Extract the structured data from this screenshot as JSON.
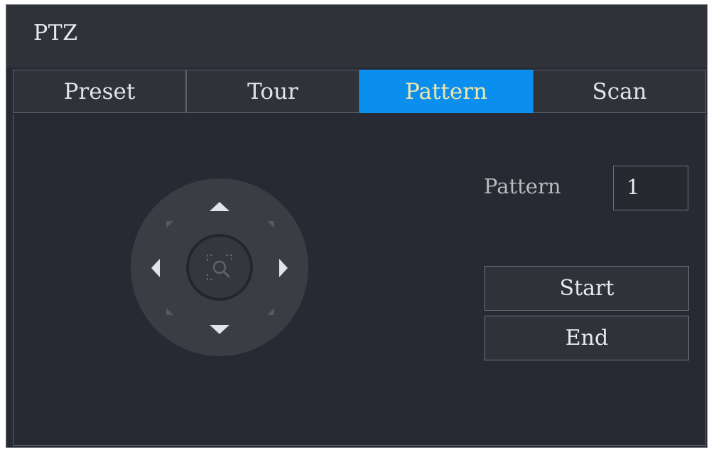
{
  "window": {
    "title": "PTZ"
  },
  "tabs": [
    {
      "label": "Preset"
    },
    {
      "label": "Tour"
    },
    {
      "label": "Pattern",
      "active": true
    },
    {
      "label": "Scan"
    }
  ],
  "pattern": {
    "label": "Pattern",
    "value": "1",
    "start_label": "Start",
    "end_label": "End"
  },
  "ptz_control": {
    "directions": [
      "up-arrow-icon",
      "down-arrow-icon",
      "left-arrow-icon",
      "right-arrow-icon"
    ],
    "center_icon": "zoom-icon"
  },
  "colors": {
    "accent": "#0b8fee",
    "active_tab_text": "#f2e7a8",
    "panel": "#272a32"
  }
}
